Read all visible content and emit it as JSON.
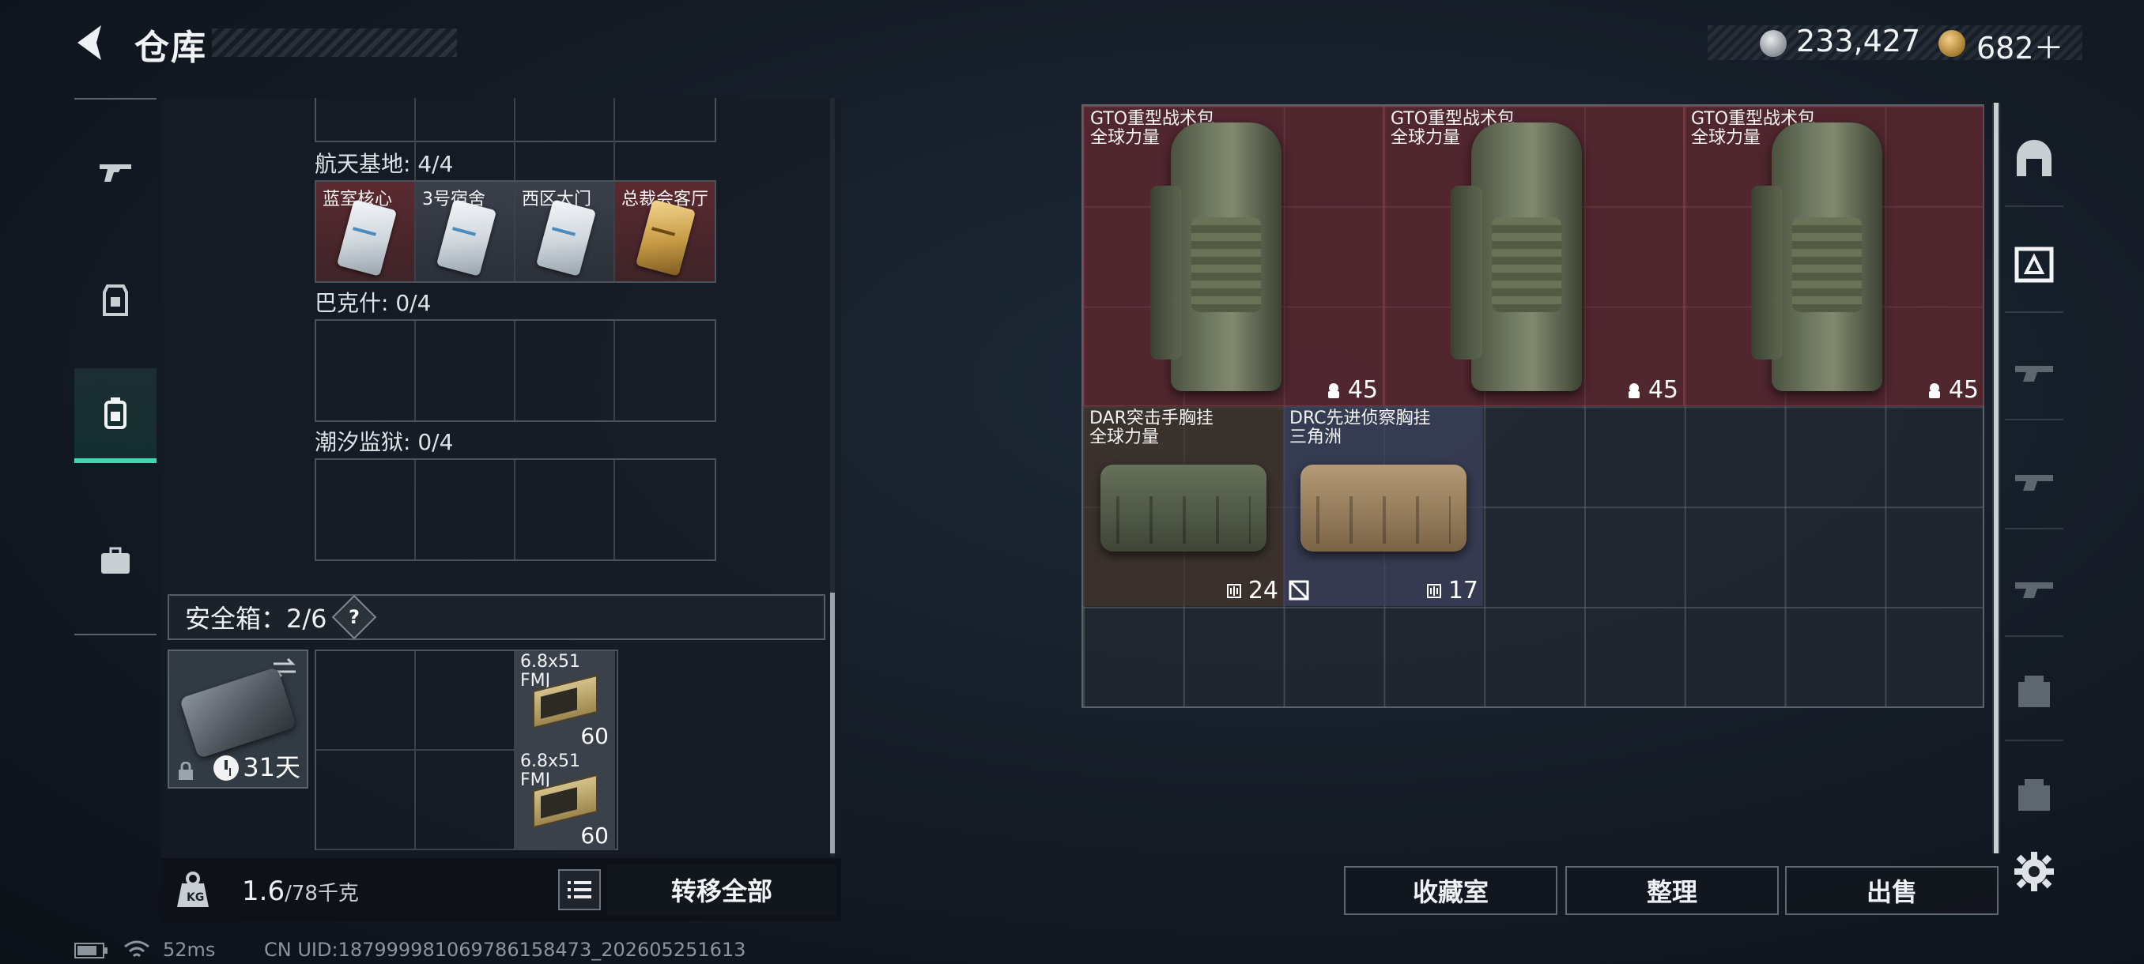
{
  "header": {
    "title": "仓库"
  },
  "currency": {
    "silver": "233,427",
    "gold": "682＋"
  },
  "left_nav": [
    "weapon-icon",
    "armor-icon",
    "backpack-icon",
    "case-icon"
  ],
  "key_sections": [
    {
      "label": "航天基地: 4/4",
      "keys": [
        "蓝室核心",
        "3号宿舍",
        "西区大门",
        "总裁会客厅"
      ]
    },
    {
      "label": "巴克什: 0/4",
      "keys": []
    },
    {
      "label": "潮汐监狱: 0/4",
      "keys": []
    }
  ],
  "safebox": {
    "label": "安全箱：2/6",
    "help": "?",
    "days": "31天"
  },
  "ammo": [
    {
      "name": "6.8x51 FMJ",
      "count": "60"
    },
    {
      "name": "6.8x51 FMJ",
      "count": "60"
    }
  ],
  "bottom": {
    "weight": "1.6",
    "capacity": "/78千克",
    "transfer": "转移全部"
  },
  "status": {
    "ping": "52ms",
    "uid": "CN UID:18799998106978615847​3_202605251613"
  },
  "items": {
    "bags": [
      {
        "name": "GTO重型战术包",
        "faction": "全球力量",
        "count": "45"
      },
      {
        "name": "GTO重型战术包",
        "faction": "全球力量",
        "count": "45"
      },
      {
        "name": "GTO重型战术包",
        "faction": "全球力量",
        "count": "45"
      }
    ],
    "vests": [
      {
        "name": "DAR突击手胸挂",
        "faction": "全球力量",
        "count": "24"
      },
      {
        "name": "DRC先进侦察胸挂",
        "faction": "三角洲",
        "count": "17"
      }
    ]
  },
  "actions": {
    "collection": "收藏室",
    "sort": "整理",
    "sell": "出售"
  },
  "colors": {
    "accent": "#3fd6b0",
    "rare_bg": "#782630",
    "epic_bg": "#3c425c"
  }
}
